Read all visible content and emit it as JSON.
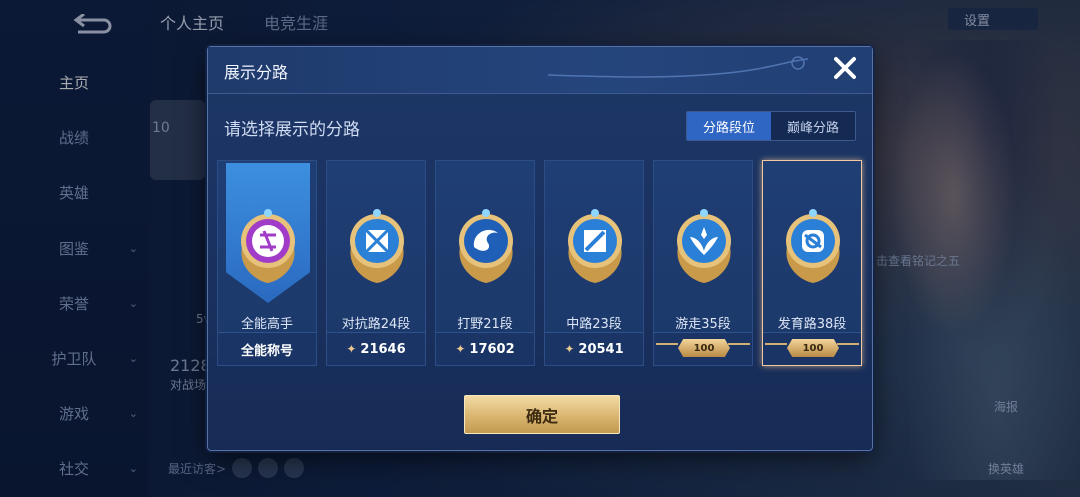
{
  "background": {
    "sidebar": [
      {
        "label": "主页",
        "active": true,
        "chevron": false
      },
      {
        "label": "战绩",
        "active": false,
        "chevron": false
      },
      {
        "label": "英雄",
        "active": false,
        "chevron": false
      },
      {
        "label": "图鉴",
        "active": false,
        "chevron": true
      },
      {
        "label": "荣誉",
        "active": false,
        "chevron": true
      },
      {
        "label": "护卫队",
        "active": false,
        "chevron": true
      },
      {
        "label": "游戏",
        "active": false,
        "chevron": true
      },
      {
        "label": "社交",
        "active": false,
        "chevron": true
      }
    ],
    "tabs": [
      "个人主页",
      "电竞生涯"
    ],
    "settings_label": "设置",
    "hint_text": "击查看铭记之五",
    "visitors_label": "最近访客>",
    "count_partial": "2128",
    "battle_partial": "对战场",
    "level_partial": "10",
    "stat_partial": "5v",
    "poster_label": "海报",
    "change_hero_label": "换英雄"
  },
  "dialog": {
    "title": "展示分路",
    "subtitle": "请选择展示的分路",
    "tabs": [
      {
        "label": "分路段位",
        "active": true
      },
      {
        "label": "巅峰分路",
        "active": false
      }
    ],
    "cards": [
      {
        "name": "全能高手",
        "footer": "全能称号",
        "points": null,
        "plaque": null,
        "badge": "all-round-badge-icon",
        "color": "#a03cc8"
      },
      {
        "name": "对抗路24段",
        "footer": null,
        "points": "21646",
        "plaque": null,
        "badge": "clash-lane-badge-icon",
        "color": "#2a7fd6"
      },
      {
        "name": "打野21段",
        "footer": null,
        "points": "17602",
        "plaque": null,
        "badge": "jungle-badge-icon",
        "color": "#2a7fd6"
      },
      {
        "name": "中路23段",
        "footer": null,
        "points": "20541",
        "plaque": null,
        "badge": "mid-lane-badge-icon",
        "color": "#2a7fd6"
      },
      {
        "name": "游走35段",
        "footer": null,
        "points": null,
        "plaque": "100",
        "badge": "roam-badge-icon",
        "color": "#2a7fd6"
      },
      {
        "name": "发育路38段",
        "footer": null,
        "points": null,
        "plaque": "100",
        "badge": "farm-lane-badge-icon",
        "color": "#2a7fd6",
        "selected": true
      }
    ],
    "confirm_label": "确定",
    "accent_gold": "#d9b570",
    "accent_blue": "#2f66c4"
  }
}
